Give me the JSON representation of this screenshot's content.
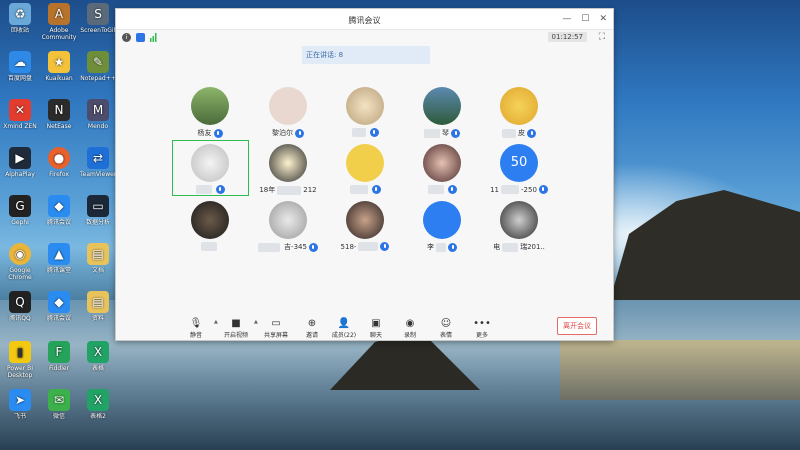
{
  "window": {
    "title": "腾讯会议",
    "timer": "01:12:57"
  },
  "speaking_banner": "正在讲话: 8",
  "participants": [
    {
      "name": "杨友",
      "mic": true
    },
    {
      "name": "黎泊尔",
      "mic": true
    },
    {
      "name": "",
      "mic": true
    },
    {
      "name": "琴",
      "mic": true
    },
    {
      "name": "皮",
      "mic": true
    },
    {
      "name": "",
      "mic": true
    },
    {
      "name": "18年",
      "name_suffix": "212",
      "mic": false
    },
    {
      "name": "",
      "mic": true
    },
    {
      "name": "",
      "mic": true
    },
    {
      "name": "11",
      "name_suffix": "-250",
      "mic": true
    },
    {
      "name": "",
      "mic": false
    },
    {
      "name": "",
      "name_suffix": "吉-345",
      "mic": true
    },
    {
      "name": "518-",
      "mic": true
    },
    {
      "name": "李",
      "mic": true
    },
    {
      "name": "电",
      "name_suffix": "瑞201..",
      "mic": false
    }
  ],
  "avatar_texts": {
    "p10": "50"
  },
  "toolbar": {
    "mute": "静音",
    "video": "开启视频",
    "share": "共享屏幕",
    "invite": "邀请",
    "members": "成员(22)",
    "chat": "聊天",
    "record": "录制",
    "reaction": "表情",
    "more": "更多",
    "leave": "离开会议"
  },
  "desktop_icons": [
    {
      "label": "回收站",
      "icon": "recycle-bin-icon",
      "color": "#6aa8d8"
    },
    {
      "label": "百度网盘",
      "icon": "baidu-netdisk-icon",
      "color": "#2e8ae6"
    },
    {
      "label": "Xmind ZEN",
      "icon": "xmind-icon",
      "color": "#e23c2f"
    },
    {
      "label": "AlphaPlay",
      "icon": "play-icon",
      "color": "#1f2a3a"
    },
    {
      "label": "Gephi",
      "icon": "gephi-icon",
      "color": "#222"
    },
    {
      "label": "Google Chrome",
      "icon": "chrome-icon",
      "color": "#e9b53a"
    },
    {
      "label": "腾讯QQ",
      "icon": "qq-icon",
      "color": "#222"
    },
    {
      "label": "Power BI Desktop",
      "icon": "powerbi-icon",
      "color": "#f2c811"
    },
    {
      "label": "飞书",
      "icon": "feishu-icon",
      "color": "#2a8cf0"
    },
    {
      "label": "Adobe Community",
      "icon": "adobe-icon",
      "color": "#b7722b"
    },
    {
      "label": "Kuaikuan",
      "icon": "star-icon",
      "color": "#f3c23a"
    },
    {
      "label": "NetEase",
      "icon": "netease-icon",
      "color": "#2b2b2b"
    },
    {
      "label": "Firefox",
      "icon": "firefox-icon",
      "color": "#e8602b"
    },
    {
      "label": "腾讯会议",
      "icon": "tencent-meeting-icon",
      "color": "#2a8cf0"
    },
    {
      "label": "腾讯课堂",
      "icon": "classroom-icon",
      "color": "#2a8cf0"
    },
    {
      "label": "腾讯会议",
      "icon": "meeting-icon",
      "color": "#2a8cf0"
    },
    {
      "label": "Fiddler",
      "icon": "fiddler-icon",
      "color": "#25a35a"
    },
    {
      "label": "微信",
      "icon": "wechat-icon",
      "color": "#3cb04a"
    },
    {
      "label": "ScreenToGif",
      "icon": "screentogif-icon",
      "color": "#5a6a7a"
    },
    {
      "label": "Notepad++",
      "icon": "notepad-icon",
      "color": "#6e8e3a"
    },
    {
      "label": "Mendo",
      "icon": "mendo-icon",
      "color": "#4c4c6c"
    },
    {
      "label": "TeamViewer",
      "icon": "teamviewer-icon",
      "color": "#1e6fd6"
    },
    {
      "label": "数据分析",
      "icon": "terminal-icon",
      "color": "#1b2838"
    },
    {
      "label": "文档",
      "icon": "folder-icon",
      "color": "#e8c25a"
    },
    {
      "label": "资料",
      "icon": "folder-icon",
      "color": "#e8c25a"
    },
    {
      "label": "表格",
      "icon": "excel-icon",
      "color": "#21a366"
    },
    {
      "label": "表格2",
      "icon": "excel-icon",
      "color": "#21a366"
    }
  ]
}
